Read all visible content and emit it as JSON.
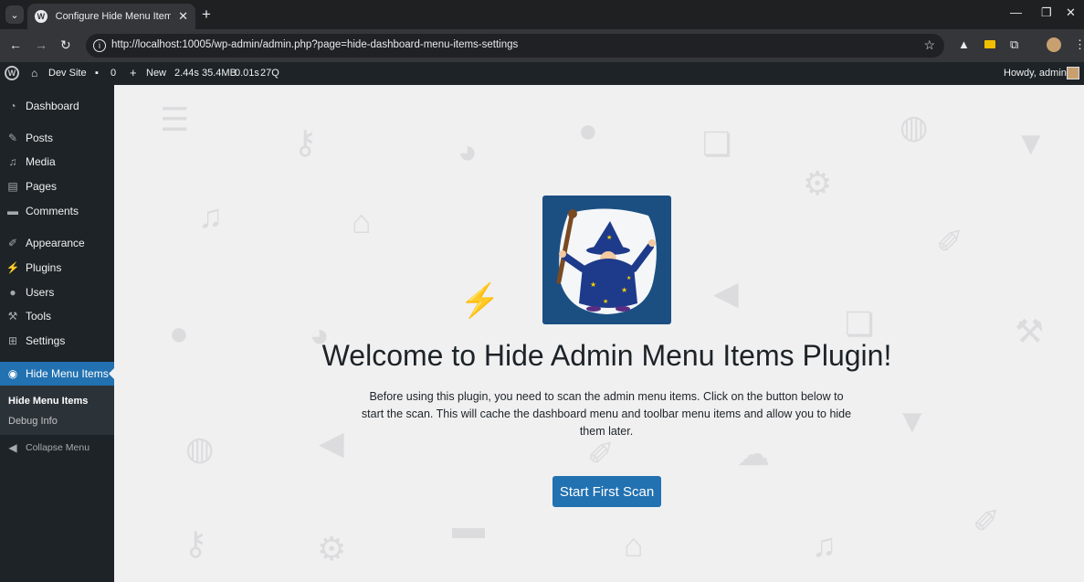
{
  "browser": {
    "tab_title": "Configure Hide Menu Items ‹ D",
    "url": "http://localhost:10005/wp-admin/admin.php?page=hide-dashboard-menu-items-settings"
  },
  "adminbar": {
    "site_name": "Dev Site",
    "comments_count": "0",
    "new_label": "New",
    "perf": [
      "2.44s",
      "35.4MB",
      "0.01s",
      "27Q"
    ],
    "howdy": "Howdy, admin"
  },
  "sidebar": {
    "items": [
      {
        "label": "Dashboard",
        "icon": "dashboard-icon"
      },
      {
        "label": "Posts",
        "icon": "pin-icon"
      },
      {
        "label": "Media",
        "icon": "media-icon"
      },
      {
        "label": "Pages",
        "icon": "pages-icon"
      },
      {
        "label": "Comments",
        "icon": "comment-icon"
      },
      {
        "label": "Appearance",
        "icon": "brush-icon"
      },
      {
        "label": "Plugins",
        "icon": "plugin-icon"
      },
      {
        "label": "Users",
        "icon": "user-icon"
      },
      {
        "label": "Tools",
        "icon": "wrench-icon"
      },
      {
        "label": "Settings",
        "icon": "settings-icon"
      },
      {
        "label": "Hide Menu Items",
        "icon": "eye-slash-icon"
      }
    ],
    "submenu": [
      "Hide Menu Items",
      "Debug Info"
    ],
    "collapse_label": "Collapse Menu"
  },
  "main": {
    "heading": "Welcome to Hide Admin Menu Items Plugin!",
    "description": "Before using this plugin, you need to scan the admin menu items. Click on the button below to start the scan. This will cache the dashboard menu and toolbar menu items and allow you to hide them later.",
    "button_label": "Start First Scan"
  },
  "colors": {
    "accent": "#2271b1",
    "sidebar_bg": "#1d2327",
    "logo_bg": "#1b4f82"
  }
}
